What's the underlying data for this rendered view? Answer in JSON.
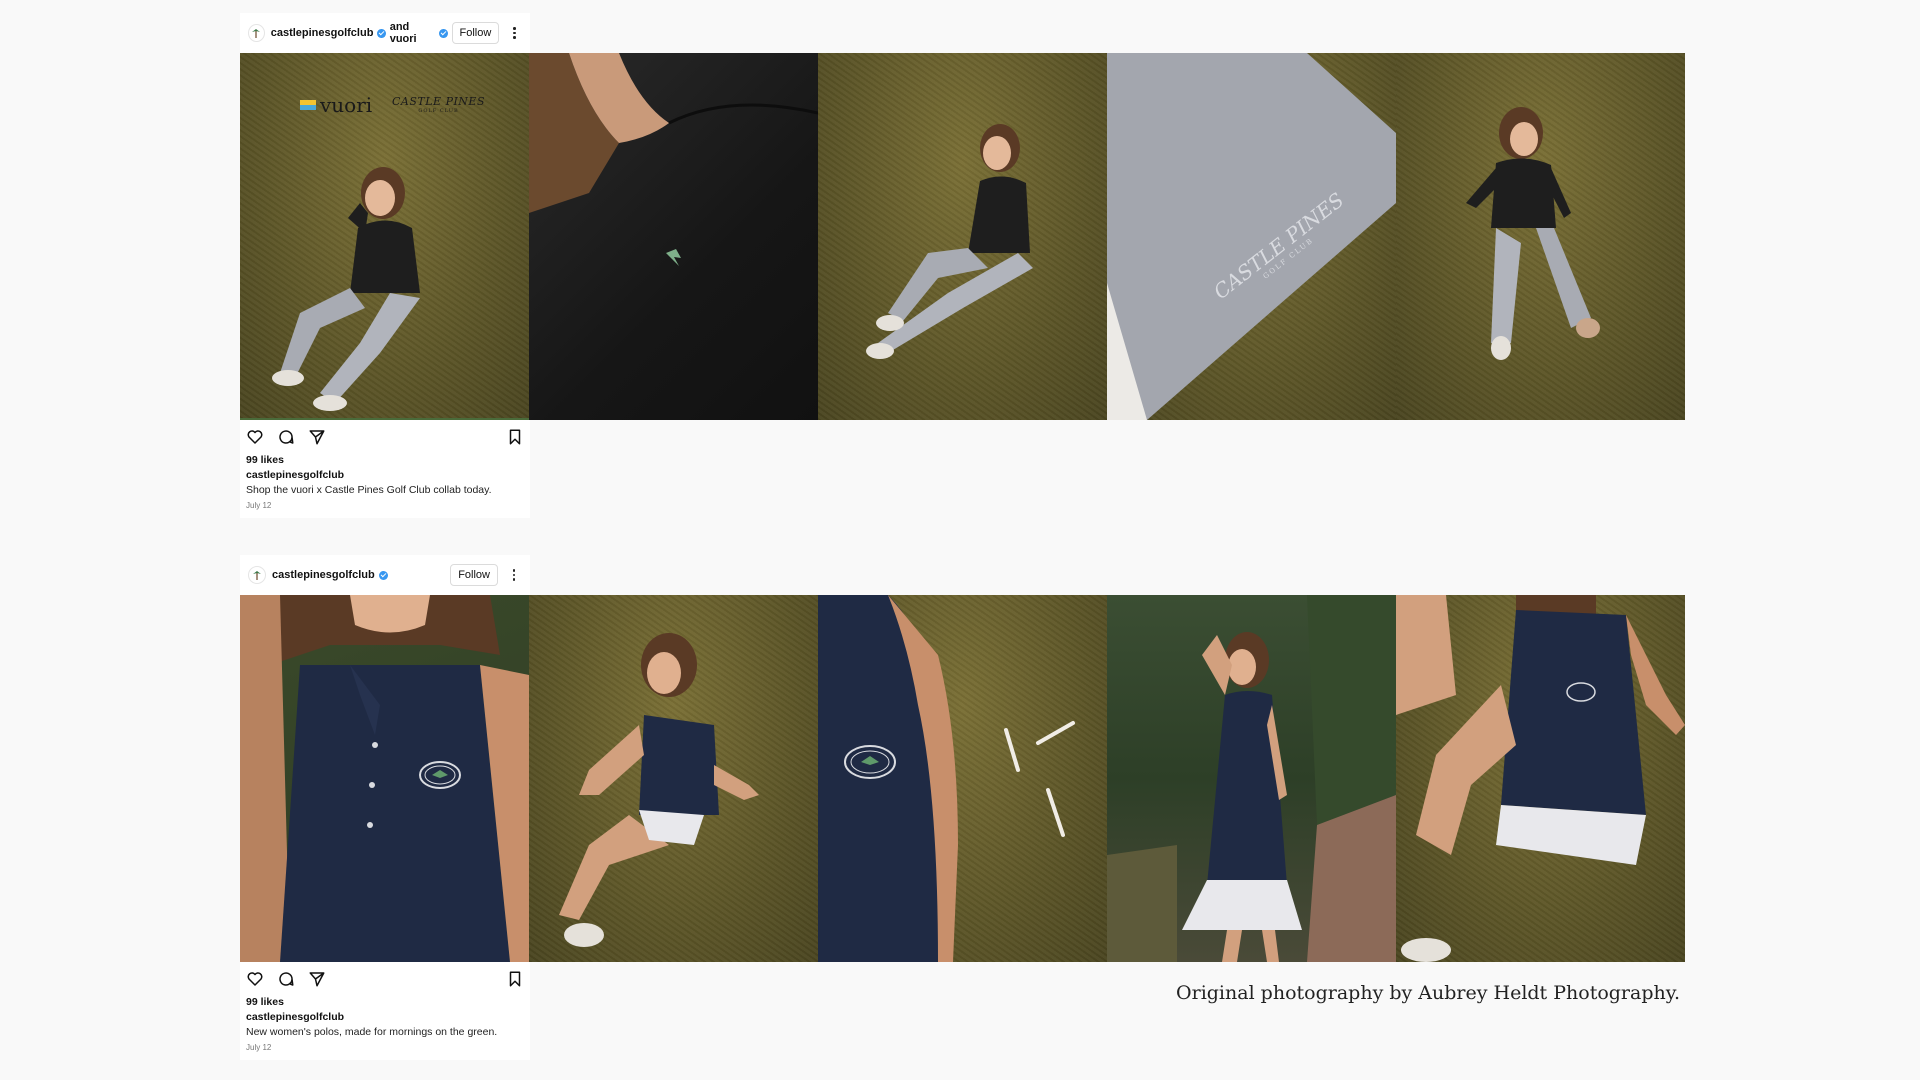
{
  "posts": [
    {
      "author": "castlepinesgolfclub",
      "collab_text": "and vuori",
      "follow_label": "Follow",
      "likes": "99 likes",
      "caption_user": "castlepinesgolfclub",
      "caption": "Shop the vuori x Castle Pines Golf Club collab today.",
      "date": "July 12",
      "brand_logo_text": "vuori",
      "club_logo_text": "CASTLE PINES",
      "club_logo_sub": "GOLF CLUB"
    },
    {
      "author": "castlepinesgolfclub",
      "follow_label": "Follow",
      "likes": "99 likes",
      "caption_user": "castlepinesgolfclub",
      "caption": "New women's polos, made for mornings on the green.",
      "date": "July 12"
    }
  ],
  "pant_logo_text": "CASTLE PINES",
  "pant_logo_sub": "GOLF CLUB",
  "credit": "Original photography by Aubrey Heldt Photography.",
  "icons": [
    "heart-icon",
    "comment-icon",
    "share-icon",
    "bookmark-icon",
    "verified-icon",
    "more-icon",
    "club-logo-icon"
  ],
  "colors": {
    "accent": "#3897f0",
    "grass": "#6b6230",
    "navy": "#1f2a44",
    "black_top": "#1c1c1c",
    "pants": "#a9acb4"
  }
}
